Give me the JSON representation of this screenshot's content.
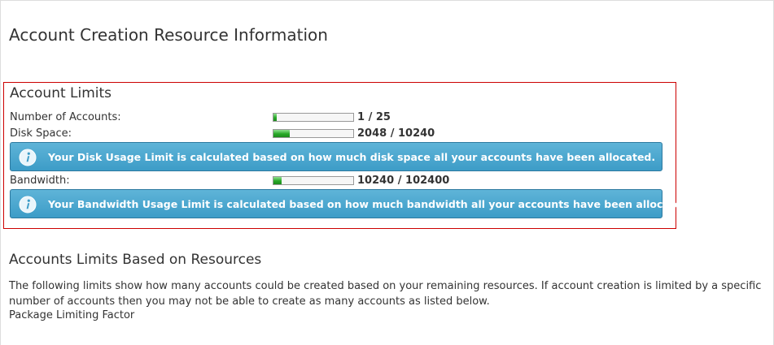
{
  "page": {
    "title": "Account Creation Resource Information"
  },
  "account_limits": {
    "title": "Account Limits",
    "rows": [
      {
        "label": "Number of Accounts:",
        "value": "1 / 25",
        "fraction": 0.04
      },
      {
        "label": "Disk Space:",
        "value": "2048 / 10240",
        "fraction": 0.2
      },
      {
        "label": "Bandwidth:",
        "value": "10240 / 102400",
        "fraction": 0.1
      }
    ],
    "disk_info": "Your Disk Usage Limit is calculated based on how much disk space all your accounts have been allocated.",
    "bandwidth_info": "Your Bandwidth Usage Limit is calculated based on how much bandwidth all your accounts have been allocated."
  },
  "resources": {
    "title": "Accounts Limits Based on Resources",
    "description": "The following limits show how many accounts could be created based on your remaining resources. If account creation is limited by a specific number of accounts then you may not be able to create as many accounts as listed below.",
    "factor_label": "Package Limiting Factor"
  },
  "icons": {
    "info": "info-icon"
  },
  "colors": {
    "highlight_border": "#cc0000",
    "info_bg": "#3d9cc7",
    "progress_fill": "#28a828"
  }
}
